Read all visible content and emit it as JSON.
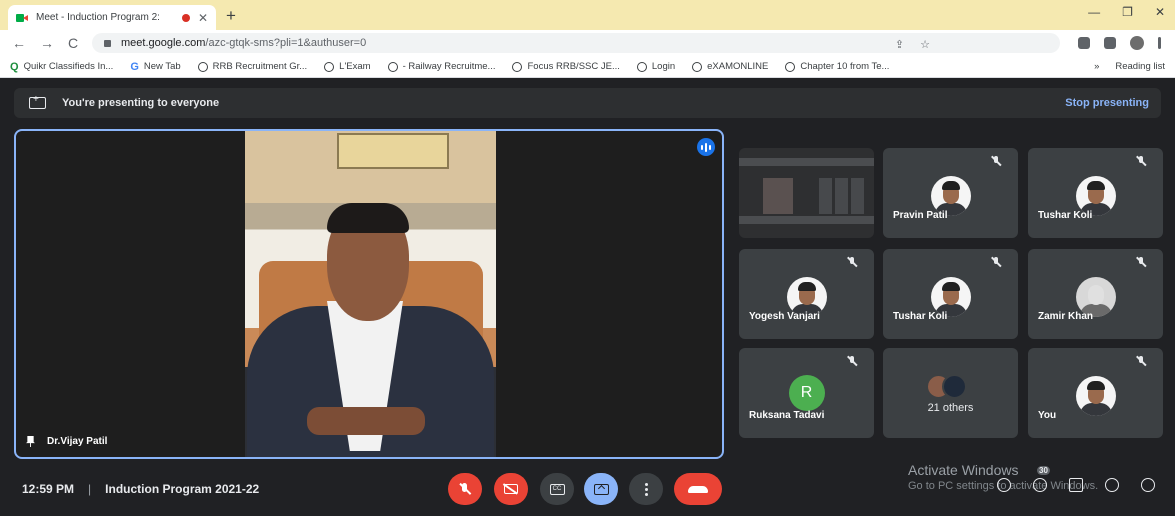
{
  "browser": {
    "tab_title": "Meet - Induction Program 2:",
    "tab_close": "✕",
    "new_tab": "+",
    "window_controls": [
      "—",
      "❐",
      "✕"
    ],
    "url_host": "meet.google.com",
    "url_path": "/azc-gtqk-sms?pli=1&authuser=0",
    "nav": [
      "←",
      "→",
      "C"
    ],
    "bookmarks": [
      {
        "label": "Quikr Classifieds In...",
        "icon": "quikr-icon"
      },
      {
        "label": "New Tab",
        "icon": "google-icon"
      },
      {
        "label": "RRB Recruitment Gr...",
        "icon": "globe-icon"
      },
      {
        "label": "L'Exam",
        "icon": "globe-icon"
      },
      {
        "label": "- Railway Recruitme...",
        "icon": "globe-icon"
      },
      {
        "label": "Focus RRB/SSC JE...",
        "icon": "globe-icon"
      },
      {
        "label": "Login",
        "icon": "globe-icon"
      },
      {
        "label": "eXAMONLINE",
        "icon": "globe-icon"
      },
      {
        "label": "Chapter 10 from Te...",
        "icon": "globe-icon"
      }
    ],
    "bookmarks_more": "»",
    "reading_list": "Reading list"
  },
  "meet": {
    "presenting_message": "You're presenting to everyone",
    "stop_presenting": "Stop presenting",
    "main_speaker": "Dr.Vijay Patil",
    "participants": [
      {
        "name": "Pravin Patil",
        "type": "photo"
      },
      {
        "name": "Tushar Koli",
        "type": "photo"
      },
      {
        "name": "Yogesh Vanjari",
        "type": "photo"
      },
      {
        "name": "Tushar Koli",
        "type": "photo"
      },
      {
        "name": "Zamir Khan",
        "type": "photo"
      },
      {
        "name": "Ruksana Tadavi",
        "type": "initial",
        "initial": "R",
        "color": "#4caf50"
      },
      {
        "name": "You",
        "type": "photo"
      }
    ],
    "others_label": "21 others",
    "time": "12:59 PM",
    "separator": "|",
    "meeting_title": "Induction Program 2021-22",
    "participant_count_badge": "30",
    "controls": [
      "mic-off-icon",
      "camera-off-icon",
      "captions-icon",
      "present-icon",
      "more-options-icon",
      "end-call-icon"
    ],
    "cc_label": "CC"
  },
  "watermark": {
    "line1": "Activate Windows",
    "line2": "Go to PC settings to activate Windows."
  },
  "colors": {
    "accent": "#8ab4f8",
    "danger": "#ea4335",
    "surface": "#3c4043",
    "background": "#202124"
  }
}
